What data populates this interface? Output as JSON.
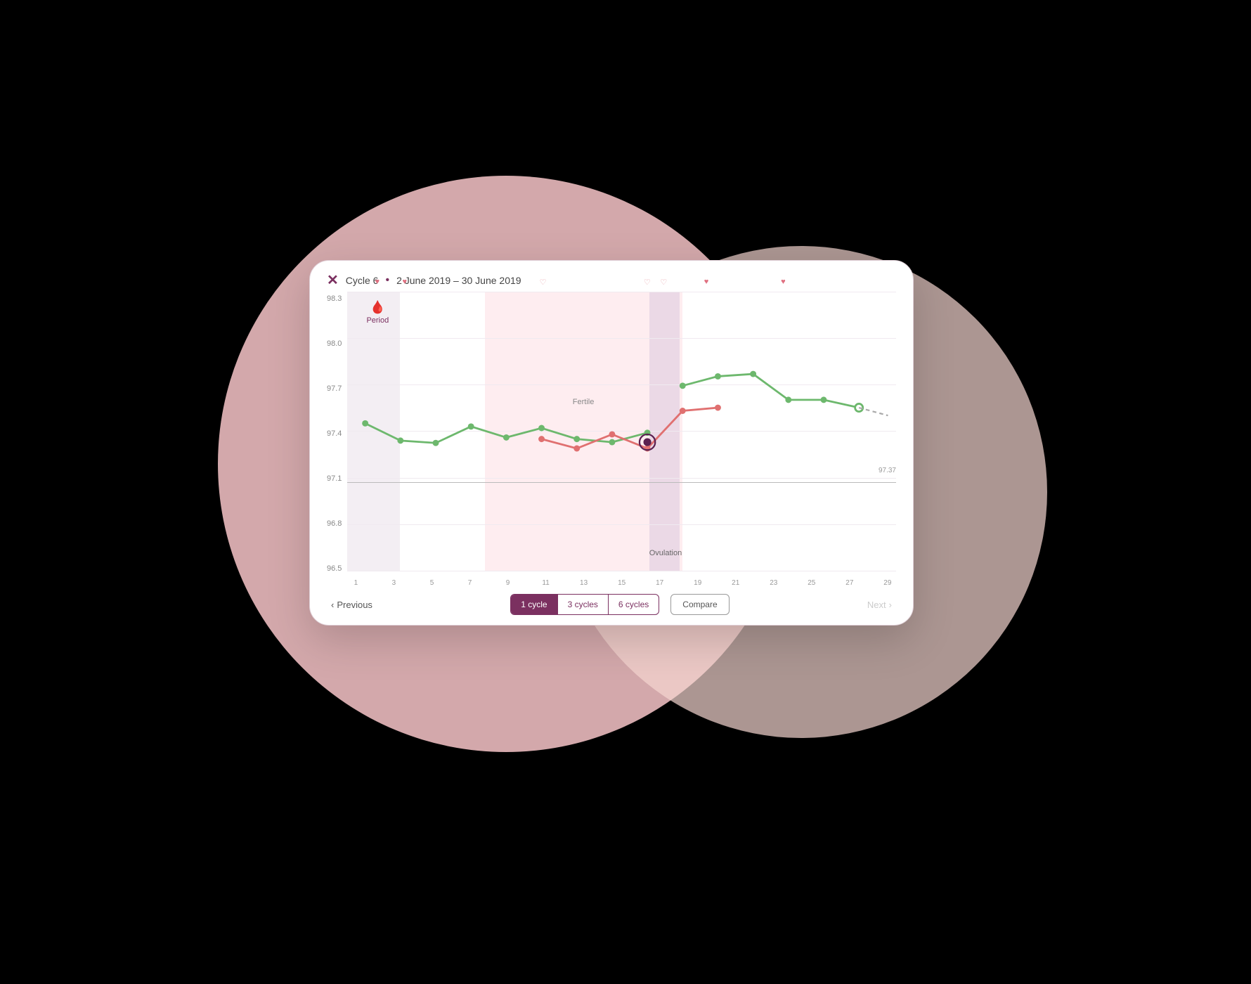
{
  "scene": {
    "background": "#000000"
  },
  "header": {
    "close_icon": "✕",
    "cycle_label": "Cycle 6",
    "date_range": "2 June 2019 – 30 June 2019"
  },
  "chart": {
    "y_labels": [
      "98.3",
      "98.0",
      "97.7",
      "97.4",
      "97.1",
      "96.8",
      "96.5"
    ],
    "x_labels": [
      "1",
      "3",
      "5",
      "7",
      "9",
      "11",
      "13",
      "15",
      "17",
      "19",
      "21",
      "23",
      "25",
      "27",
      "29"
    ],
    "threshold_value": "97.37",
    "zones": {
      "period_label": "Period",
      "fertile_label": "Fertile",
      "ovulation_label": "Ovulation"
    }
  },
  "nav": {
    "previous_label": "Previous",
    "next_label": "Next",
    "tabs": [
      {
        "label": "1 cycle",
        "active": true
      },
      {
        "label": "3 cycles",
        "active": false
      },
      {
        "label": "6 cycles",
        "active": false
      }
    ],
    "compare_label": "Compare"
  }
}
